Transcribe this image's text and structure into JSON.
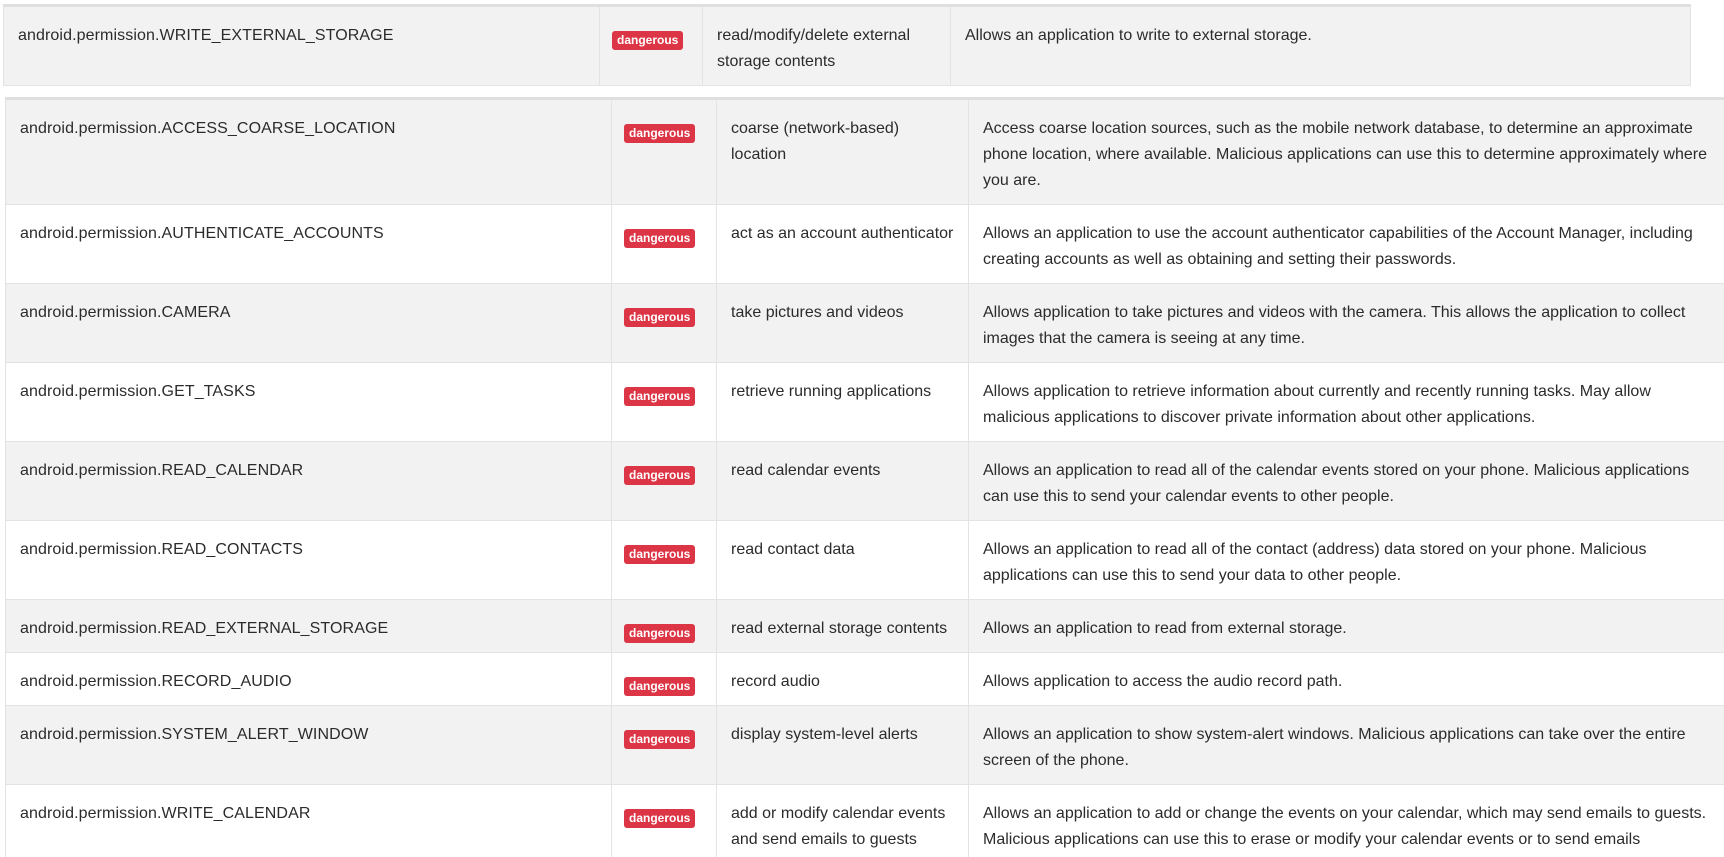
{
  "badge_label": "dangerous",
  "colors": {
    "badge_bg": "#dc3545",
    "row_alt": "#f2f2f2",
    "border": "#e3e3e3"
  },
  "top_table": {
    "rows": [
      {
        "permission": "android.permission.WRITE_EXTERNAL_STORAGE",
        "status": "dangerous",
        "info": "read/modify/delete external storage contents",
        "description": "Allows an application to write to external storage."
      }
    ]
  },
  "main_table": {
    "rows": [
      {
        "permission": "android.permission.ACCESS_COARSE_LOCATION",
        "status": "dangerous",
        "info": "coarse (network-based) location",
        "description": "Access coarse location sources, such as the mobile network database, to determine an approximate phone location, where available. Malicious applications can use this to determine approximately where you are."
      },
      {
        "permission": "android.permission.AUTHENTICATE_ACCOUNTS",
        "status": "dangerous",
        "info": "act as an account authenticator",
        "description": "Allows an application to use the account authenticator capabilities of the Account Manager, including creating accounts as well as obtaining and setting their passwords."
      },
      {
        "permission": "android.permission.CAMERA",
        "status": "dangerous",
        "info": "take pictures and videos",
        "description": "Allows application to take pictures and videos with the camera. This allows the application to collect images that the camera is seeing at any time."
      },
      {
        "permission": "android.permission.GET_TASKS",
        "status": "dangerous",
        "info": "retrieve running applications",
        "description": "Allows application to retrieve information about currently and recently running tasks. May allow malicious applications to discover private information about other applications."
      },
      {
        "permission": "android.permission.READ_CALENDAR",
        "status": "dangerous",
        "info": "read calendar events",
        "description": "Allows an application to read all of the calendar events stored on your phone. Malicious applications can use this to send your calendar events to other people."
      },
      {
        "permission": "android.permission.READ_CONTACTS",
        "status": "dangerous",
        "info": "read contact data",
        "description": "Allows an application to read all of the contact (address) data stored on your phone. Malicious applications can use this to send your data to other people."
      },
      {
        "permission": "android.permission.READ_EXTERNAL_STORAGE",
        "status": "dangerous",
        "info": "read external storage contents",
        "description": "Allows an application to read from external storage."
      },
      {
        "permission": "android.permission.RECORD_AUDIO",
        "status": "dangerous",
        "info": "record audio",
        "description": "Allows application to access the audio record path."
      },
      {
        "permission": "android.permission.SYSTEM_ALERT_WINDOW",
        "status": "dangerous",
        "info": "display system-level alerts",
        "description": "Allows an application to show system-alert windows. Malicious applications can take over the entire screen of the phone."
      },
      {
        "permission": "android.permission.WRITE_CALENDAR",
        "status": "dangerous",
        "info": "add or modify calendar events and send emails to guests",
        "description": "Allows an application to add or change the events on your calendar, which may send emails to guests. Malicious applications can use this to erase or modify your calendar events or to send emails"
      }
    ]
  }
}
